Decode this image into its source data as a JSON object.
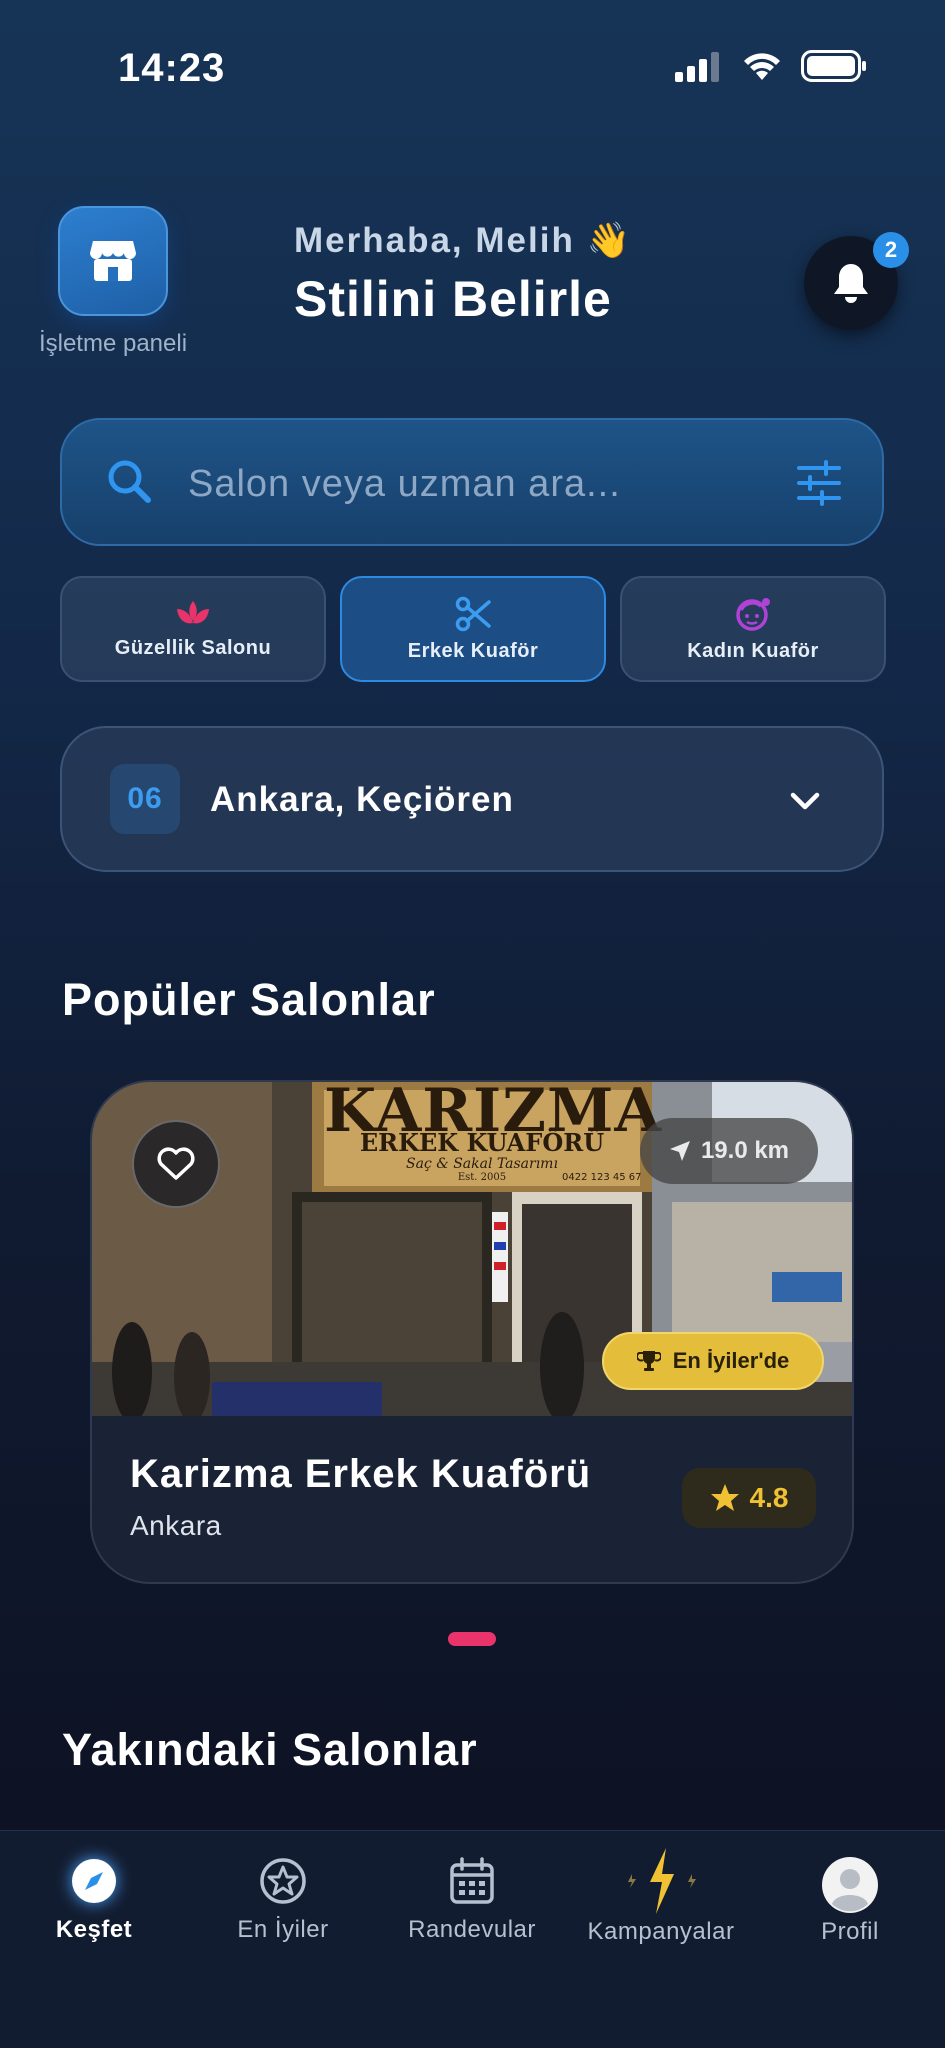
{
  "status_bar": {
    "time": "14:23"
  },
  "header": {
    "store_label": "İşletme paneli",
    "greeting": "Merhaba, Melih 👋",
    "headline": "Stilini Belirle",
    "notification_count": "2"
  },
  "search": {
    "placeholder": "Salon veya uzman ara..."
  },
  "categories": [
    {
      "label": "Güzellik Salonu",
      "icon": "lotus-icon",
      "color": "#e8336b",
      "active": false
    },
    {
      "label": "Erkek Kuaför",
      "icon": "scissors-icon",
      "color": "#3b9cf0",
      "active": true
    },
    {
      "label": "Kadın Kuaför",
      "icon": "woman-face-icon",
      "color": "#b042d8",
      "active": false
    }
  ],
  "location": {
    "code": "06",
    "name": "Ankara, Keçiören"
  },
  "popular": {
    "title": "Popüler Salonlar",
    "salon": {
      "name": "Karizma Erkek Kuaförü",
      "city": "Ankara",
      "distance": "19.0 km",
      "badge": "En İyiler'de",
      "rating": "4.8",
      "sign_line1": "KARIZMA",
      "sign_line2": "ERKEK KUAFÖRÜ",
      "sign_line3": "Saç & Sakal Tasarımı",
      "sign_est": "Est. 2005",
      "sign_phone": "0422 123 45 67"
    }
  },
  "nearby": {
    "title": "Yakındaki Salonlar"
  },
  "nav": [
    {
      "label": "Keşfet",
      "icon": "compass-icon",
      "active": true
    },
    {
      "label": "En İyiler",
      "icon": "star-badge-icon",
      "active": false
    },
    {
      "label": "Randevular",
      "icon": "calendar-icon",
      "active": false
    },
    {
      "label": "Kampanyalar",
      "icon": "lightning-icon",
      "active": false
    },
    {
      "label": "Profil",
      "icon": "avatar-icon",
      "active": false
    }
  ],
  "colors": {
    "accent": "#2a8fe6",
    "pink": "#e8336b",
    "gold": "#e4be3a"
  }
}
